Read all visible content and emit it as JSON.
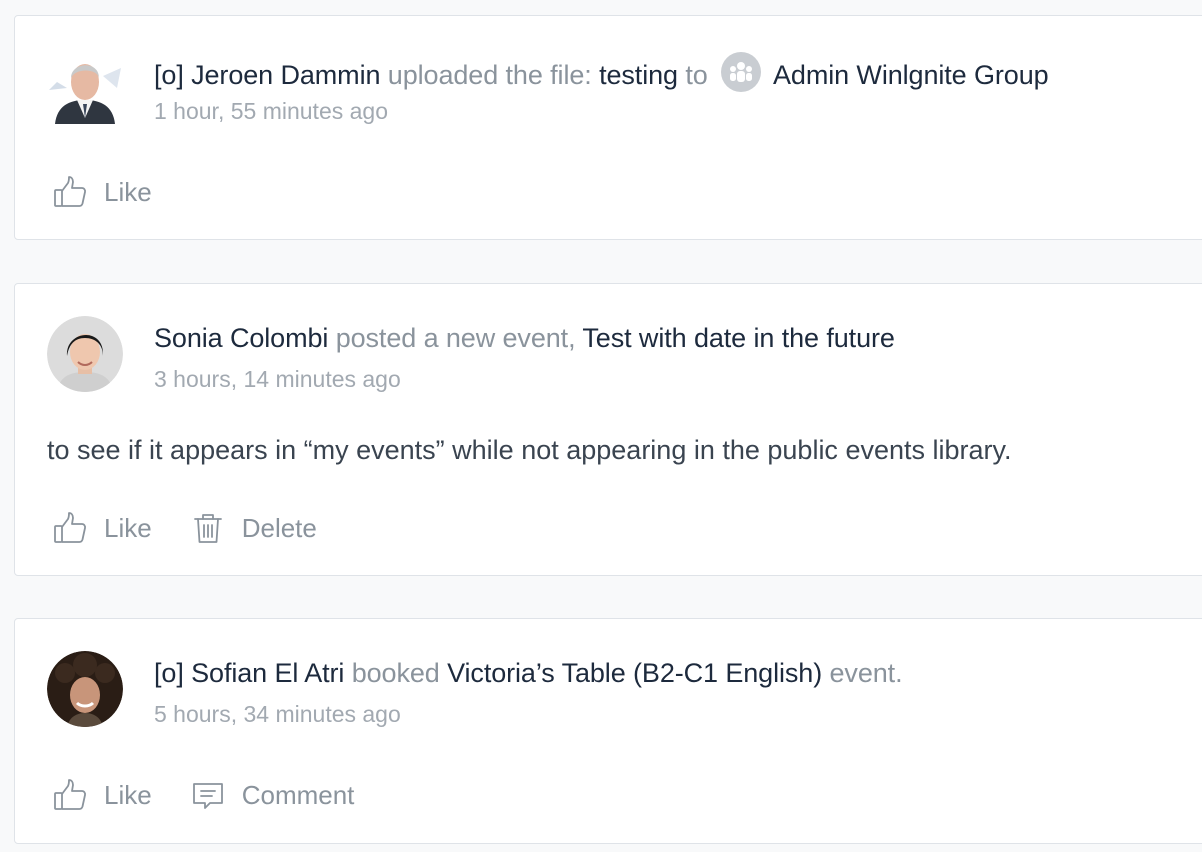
{
  "feed": [
    {
      "actor": "[o] Jeroen Dammin",
      "verb": "uploaded the file:",
      "object": "testing",
      "connector": "to",
      "group": "Admin Winlgnite Group",
      "time": "1 hour, 55 minutes ago",
      "actions": {
        "like": "Like"
      }
    },
    {
      "actor": "Sonia Colombi",
      "verb": "posted a new event,",
      "object": "Test with date in the future",
      "time": "3 hours, 14 minutes ago",
      "body": "to see if it appears in “my events” while not appearing in the public events library.",
      "actions": {
        "like": "Like",
        "delete": "Delete"
      }
    },
    {
      "actor": "[o] Sofian El Atri",
      "verb": "booked",
      "object": "Victoria’s Table (B2-C1 English)",
      "suffix": "event.",
      "time": "5 hours, 34 minutes ago",
      "actions": {
        "like": "Like",
        "comment": "Comment"
      }
    }
  ],
  "icons": {
    "like": "thumbs-up-icon",
    "delete": "trash-icon",
    "comment": "comment-icon",
    "group": "group-icon"
  },
  "colors": {
    "name": "#1d2a3d",
    "muted": "#8a939c",
    "timestamp": "#a2a9b1",
    "card_border": "#dfe3e8",
    "page_bg": "#f8f9fa"
  }
}
